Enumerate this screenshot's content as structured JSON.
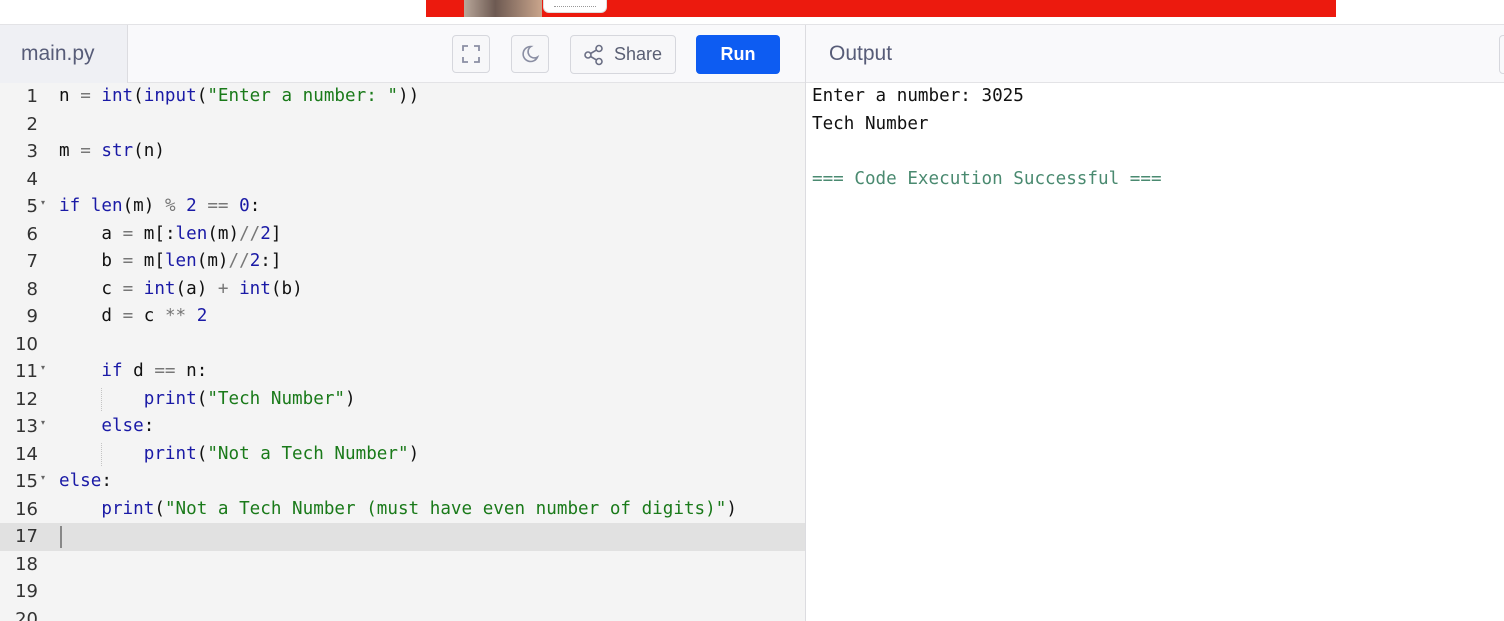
{
  "header": {
    "file_name": "main.py",
    "share_label": "Share",
    "run_label": "Run",
    "output_title": "Output",
    "fullscreen_icon": "fullscreen-icon",
    "theme_icon": "moon-icon",
    "share_icon": "share-icon"
  },
  "colors": {
    "run_button": "#0d5cf2",
    "ad_banner": "#ec1a0e",
    "keyword": "#1a1aa6",
    "string": "#1a7a1a",
    "success": "#4a8a70"
  },
  "editor": {
    "active_line": 17,
    "lines": [
      {
        "num": "1",
        "text": "n = int(input(\"Enter a number: \"))"
      },
      {
        "num": "2",
        "text": ""
      },
      {
        "num": "3",
        "text": "m = str(n)"
      },
      {
        "num": "4",
        "text": ""
      },
      {
        "num": "5",
        "text": "if len(m) % 2 == 0:"
      },
      {
        "num": "6",
        "text": "    a = m[:len(m)//2]"
      },
      {
        "num": "7",
        "text": "    b = m[len(m)//2:]"
      },
      {
        "num": "8",
        "text": "    c = int(a) + int(b)"
      },
      {
        "num": "9",
        "text": "    d = c ** 2"
      },
      {
        "num": "10",
        "text": ""
      },
      {
        "num": "11",
        "text": "    if d == n:"
      },
      {
        "num": "12",
        "text": "        print(\"Tech Number\")"
      },
      {
        "num": "13",
        "text": "    else:"
      },
      {
        "num": "14",
        "text": "        print(\"Not a Tech Number\")"
      },
      {
        "num": "15",
        "text": "else:"
      },
      {
        "num": "16",
        "text": "    print(\"Not a Tech Number (must have even number of digits)\")"
      },
      {
        "num": "17",
        "text": ""
      },
      {
        "num": "18",
        "text": ""
      },
      {
        "num": "19",
        "text": ""
      },
      {
        "num": "20",
        "text": ""
      }
    ]
  },
  "output": {
    "lines": [
      "Enter a number: 3025",
      "Tech Number",
      "",
      "=== Code Execution Successful ==="
    ]
  }
}
